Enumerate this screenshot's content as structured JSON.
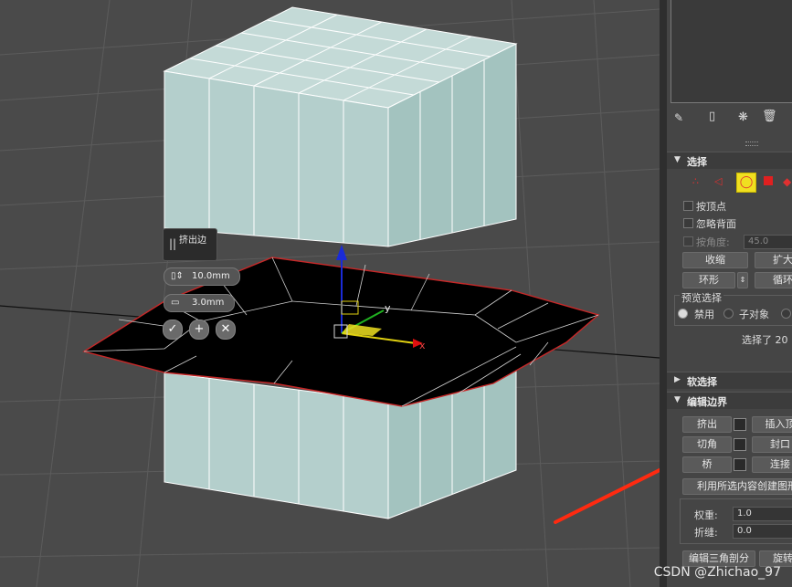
{
  "caddy": {
    "title": "挤出边",
    "height_value": "10.0mm",
    "width_value": "3.0mm"
  },
  "gizmo": {
    "x_label": "x",
    "y_label": "y"
  },
  "panel": {
    "selection": {
      "title": "选择",
      "by_vertex": "按顶点",
      "ignore_backfacing": "忽略背面",
      "by_angle": "按角度:",
      "angle_value": "45.0",
      "shrink": "收缩",
      "grow": "扩大",
      "ring": "环形",
      "loop": "循环",
      "preview_title": "预览选择",
      "preview_off": "禁用",
      "preview_subobj": "子对象",
      "status": "选择了 20"
    },
    "soft_selection": {
      "title": "软选择"
    },
    "edit_borders": {
      "title": "编辑边界",
      "extrude": "挤出",
      "insert_vertex": "插入顶",
      "chamfer": "切角",
      "cap": "封口",
      "bridge": "桥",
      "connect": "连接",
      "create_shape": "利用所选内容创建图形",
      "weight_label": "权重:",
      "weight_value": "1.0",
      "crease_label": "折缝:",
      "crease_value": "0.0",
      "edit_tri": "编辑三角剖分",
      "turn": "旋转"
    }
  },
  "watermark": "CSDN @Zhichao_97",
  "colors": {
    "highlight_yellow": "#f0e020",
    "arrow_red": "#ff2a10"
  }
}
